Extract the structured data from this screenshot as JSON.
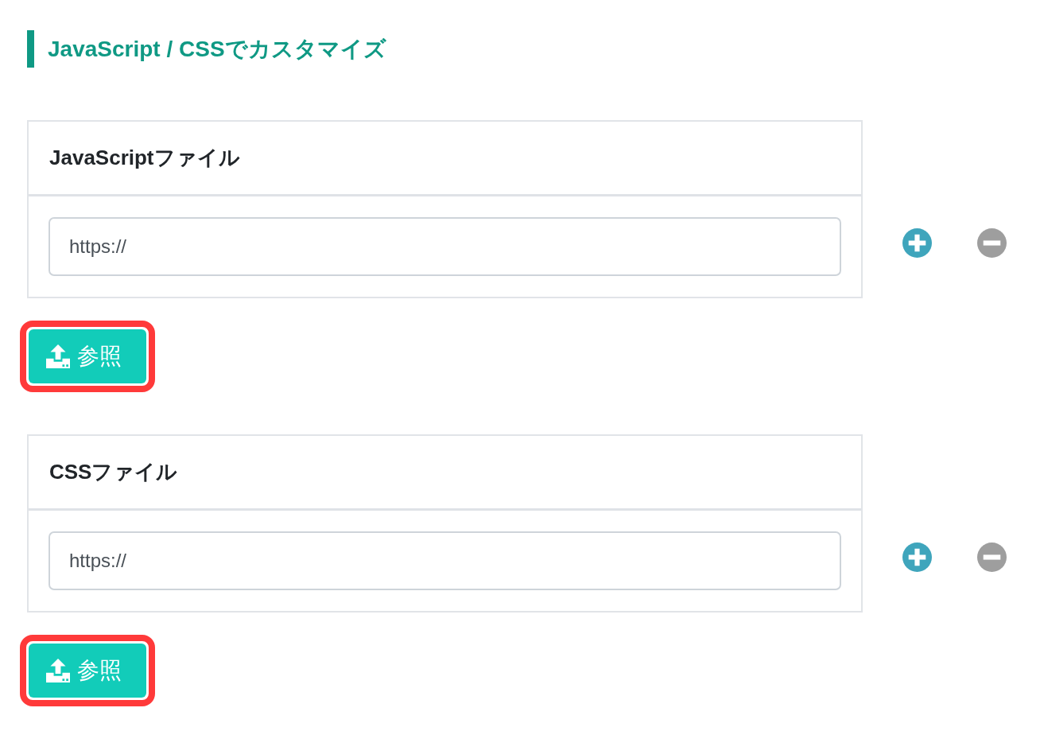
{
  "section": {
    "title": "JavaScript / CSSでカスタマイズ"
  },
  "file_groups": [
    {
      "title": "JavaScriptファイル",
      "url_field": {
        "value": "https://"
      },
      "browse_button": {
        "label": "参照",
        "highlighted": true
      }
    },
    {
      "title": "CSSファイル",
      "url_field": {
        "value": "https://"
      },
      "browse_button": {
        "label": "参照",
        "highlighted": true
      }
    }
  ]
}
